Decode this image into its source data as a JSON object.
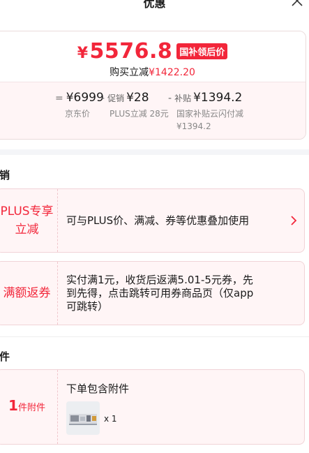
{
  "header": {
    "title": "优惠"
  },
  "price_summary": {
    "final_price_yen": "¥",
    "final_price": "5576.8",
    "final_badge": "国补领后价",
    "reduce_label": "购买立减",
    "reduce_amount": "¥1422.20",
    "breakdown": [
      {
        "operator": "=",
        "prefix": "",
        "value": "¥6999",
        "desc": "京东价"
      },
      {
        "operator": "-",
        "prefix": "促销",
        "value": "¥28",
        "desc": "PLUS立减 28元"
      },
      {
        "operator": "-",
        "prefix": "补贴",
        "value": "¥1394.2",
        "desc": "国家补贴云闪付减",
        "desc2": "¥1394.2"
      }
    ]
  },
  "promotions": {
    "title": "促销",
    "items": [
      {
        "tag_line1": "PLUS专享",
        "tag_line2": "立减",
        "text": "可与PLUS价、满减、券等优惠叠加使用"
      },
      {
        "tag_line1": "满额返券",
        "lines": [
          "实付满1元，收货后返满5.01-5元券，先",
          "到先得，点击跳转可用券商品页（仅app",
          "可跳转）"
        ]
      }
    ]
  },
  "accessories": {
    "title": "附件",
    "count": "1",
    "unit": "件附件",
    "text": "下单包含附件",
    "qty": "x 1"
  },
  "colors": {
    "accent": "#f2263a",
    "card_bg": "#fff5f6"
  },
  "icons": {
    "close": "close-icon",
    "chevron": "chevron-right-icon"
  }
}
